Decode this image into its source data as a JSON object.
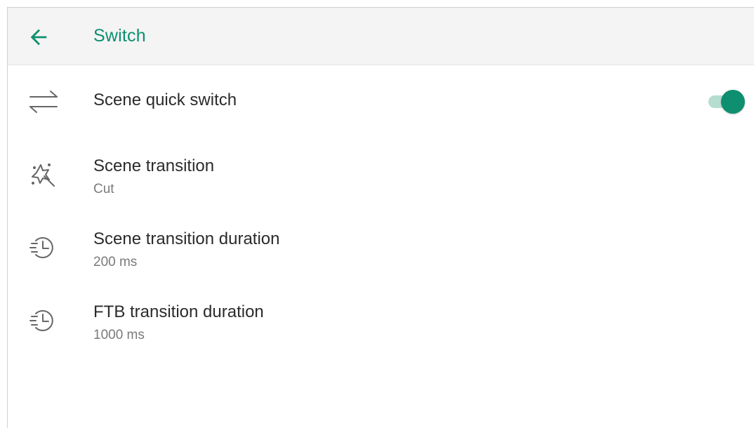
{
  "appbar": {
    "title": "Switch",
    "back_icon": "arrow-back-icon"
  },
  "settings": [
    {
      "icon": "swap-arrows-icon",
      "title": "Scene quick switch",
      "subtitle": "",
      "toggle_on": true
    },
    {
      "icon": "magic-sparkle-icon",
      "title": "Scene transition",
      "subtitle": "Cut"
    },
    {
      "icon": "timer-history-icon",
      "title": "Scene transition duration",
      "subtitle": "200 ms"
    },
    {
      "icon": "timer-history-icon",
      "title": "FTB transition duration",
      "subtitle": "1000 ms"
    }
  ],
  "colors": {
    "accent": "#0e8f6f",
    "toggle_track": "#b5ddd0",
    "title_text": "#2b2b2b",
    "subtitle_text": "#7a7a7a",
    "appbar_bg": "#f4f4f4"
  }
}
